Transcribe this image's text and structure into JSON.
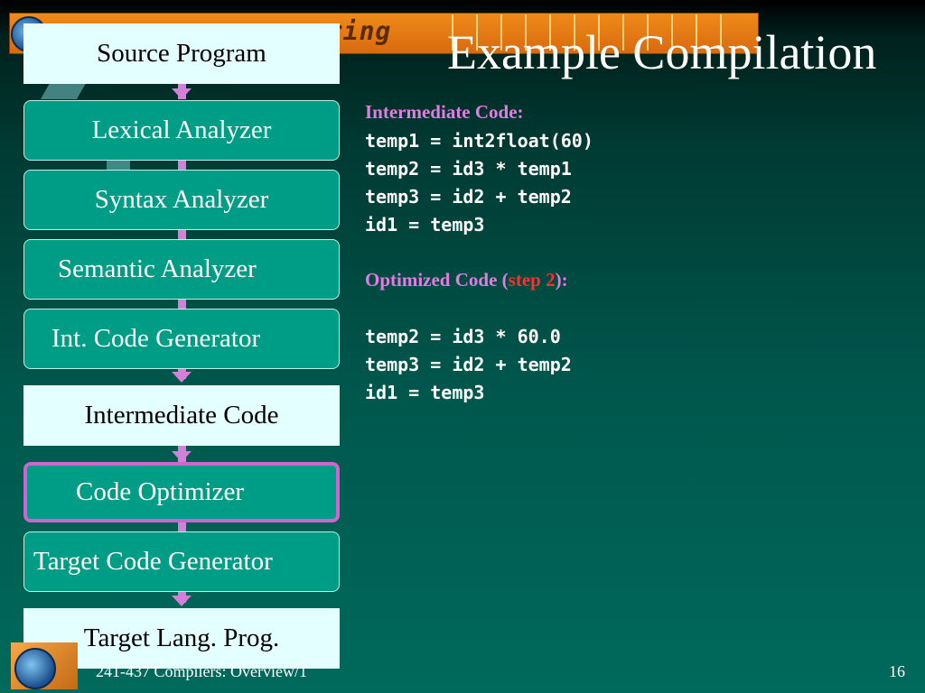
{
  "slide": {
    "title": "Example Compilation",
    "banner_text": "ering",
    "page_number": "16",
    "footer": "241-437 Compilers: Overview/1"
  },
  "pipeline": {
    "source_program": "Source Program",
    "lexical_analyzer": "Lexical Analyzer",
    "syntax_analyzer": "Syntax Analyzer",
    "semantic_analyzer": "Semantic Analyzer",
    "int_code_generator": "Int. Code Generator",
    "intermediate_code": "Intermediate Code",
    "code_optimizer": "Code Optimizer",
    "target_code_generator": "Target Code Generator",
    "target_lang_prog": "Target Lang. Prog."
  },
  "code": {
    "intermediate_heading": "Intermediate Code:",
    "intermediate_lines": [
      "temp1 = int2float(60)",
      "temp2 = id3 * temp1",
      "temp3 = id2 + temp2",
      "id1 = temp3"
    ],
    "optimized_heading_prefix": "Optimized Code (",
    "optimized_heading_step": "step 2",
    "optimized_heading_suffix": "):",
    "optimized_lines": [
      "temp2 = id3 * 60.0",
      "temp3 = id2 + temp2",
      "id1 = temp3"
    ]
  },
  "colors": {
    "heading": "#e07ee0",
    "step_highlight": "#ff2d2d",
    "box_teal": "#009d86",
    "box_light": "#e4ffff",
    "connector": "#d47fd8"
  }
}
